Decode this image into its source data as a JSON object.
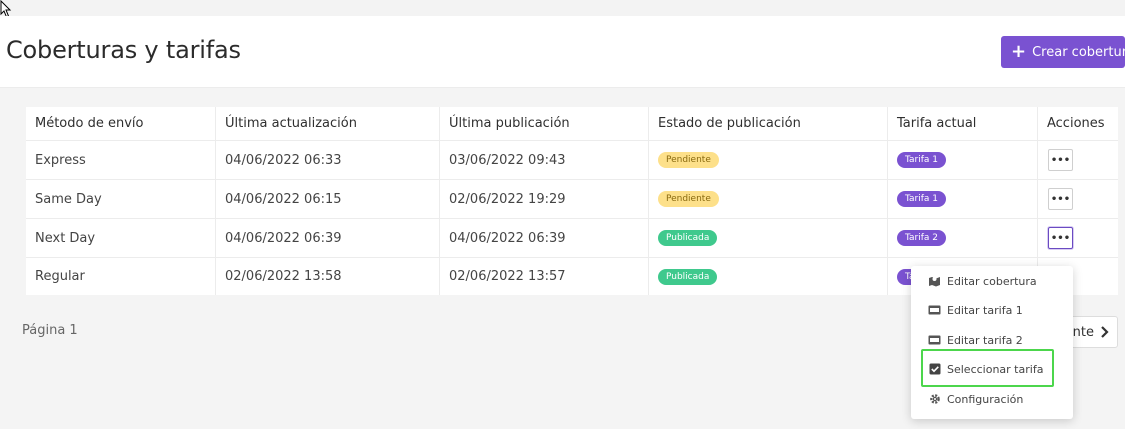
{
  "header": {
    "title": "Coberturas y tarifas",
    "create_button_label": "Crear cobertura"
  },
  "table": {
    "columns": [
      "Método de envío",
      "Última actualización",
      "Última publicación",
      "Estado de publicación",
      "Tarifa actual",
      "Acciones"
    ],
    "rows": [
      {
        "method": "Express",
        "updated": "04/06/2022 06:33",
        "published": "03/06/2022 09:43",
        "status": "Pendiente",
        "tariff": "Tarifa 1"
      },
      {
        "method": "Same Day",
        "updated": "04/06/2022 06:15",
        "published": "02/06/2022 19:29",
        "status": "Pendiente",
        "tariff": "Tarifa 1"
      },
      {
        "method": "Next Day",
        "updated": "04/06/2022 06:39",
        "published": "04/06/2022 06:39",
        "status": "Publicada",
        "tariff": "Tarifa 2"
      },
      {
        "method": "Regular",
        "updated": "02/06/2022 13:58",
        "published": "02/06/2022 13:57",
        "status": "Publicada",
        "tariff": "Ta"
      }
    ],
    "actions_glyph": "•••"
  },
  "pagination": {
    "page_label": "Página 1",
    "next_label": "nte"
  },
  "context_menu": {
    "items": [
      {
        "label": "Editar cobertura",
        "icon": "map-icon"
      },
      {
        "label": "Editar tarifa 1",
        "icon": "card-icon"
      },
      {
        "label": "Editar tarifa 2",
        "icon": "card-icon"
      },
      {
        "label": "Seleccionar tarifa",
        "icon": "check-square-icon"
      },
      {
        "label": "Configuración",
        "icon": "gear-icon"
      }
    ]
  },
  "colors": {
    "accent": "#7a52d1",
    "pending": "#fde08a",
    "published": "#3fc98d",
    "highlight": "#4cd64c"
  }
}
